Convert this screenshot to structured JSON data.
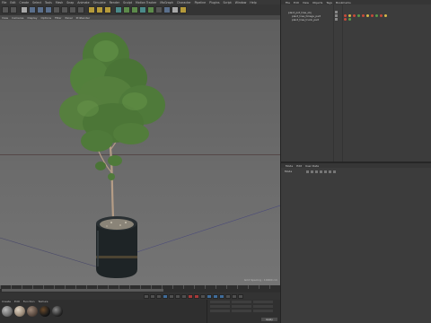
{
  "menubar": {
    "items": [
      "File",
      "Edit",
      "Create",
      "Select",
      "Tools",
      "Mesh",
      "Snap",
      "Animate",
      "Simulate",
      "Render",
      "Sculpt",
      "Motion Tracker",
      "MoGraph",
      "Character",
      "Pipeline",
      "Plugins",
      "Script",
      "Window",
      "Help"
    ]
  },
  "viewport": {
    "menu": [
      "View",
      "Cameras",
      "Display",
      "Options",
      "Filter",
      "Panel",
      "ProRender"
    ],
    "info": "Grid Spacing : 10000 cm"
  },
  "object_manager": {
    "menu": [
      "File",
      "Edit",
      "View",
      "Objects",
      "Tags",
      "Bookmarks"
    ],
    "objects": [
      {
        "name": "plant_pot_tree_obj"
      },
      {
        "name": "plant_tree_foliage_part"
      },
      {
        "name": "plant_tree_trunk_part"
      }
    ]
  },
  "attribute_manager": {
    "menu": [
      "Mode",
      "Edit",
      "User Data"
    ],
    "header": "Mode"
  },
  "coordinates": {
    "apply_label": "Apply"
  },
  "materials": {
    "menu": [
      "Create",
      "Edit",
      "Function",
      "Texture"
    ],
    "swatches": [
      "#6e6e6e",
      "#9a8a78",
      "#5a4a40",
      "#1a1a1a",
      "#2a2a2a"
    ]
  },
  "colors": {
    "accent": "#3f6c9a",
    "record": "#a53a3a",
    "foliage": "#4f7a3a",
    "pot": "#1e2426"
  }
}
